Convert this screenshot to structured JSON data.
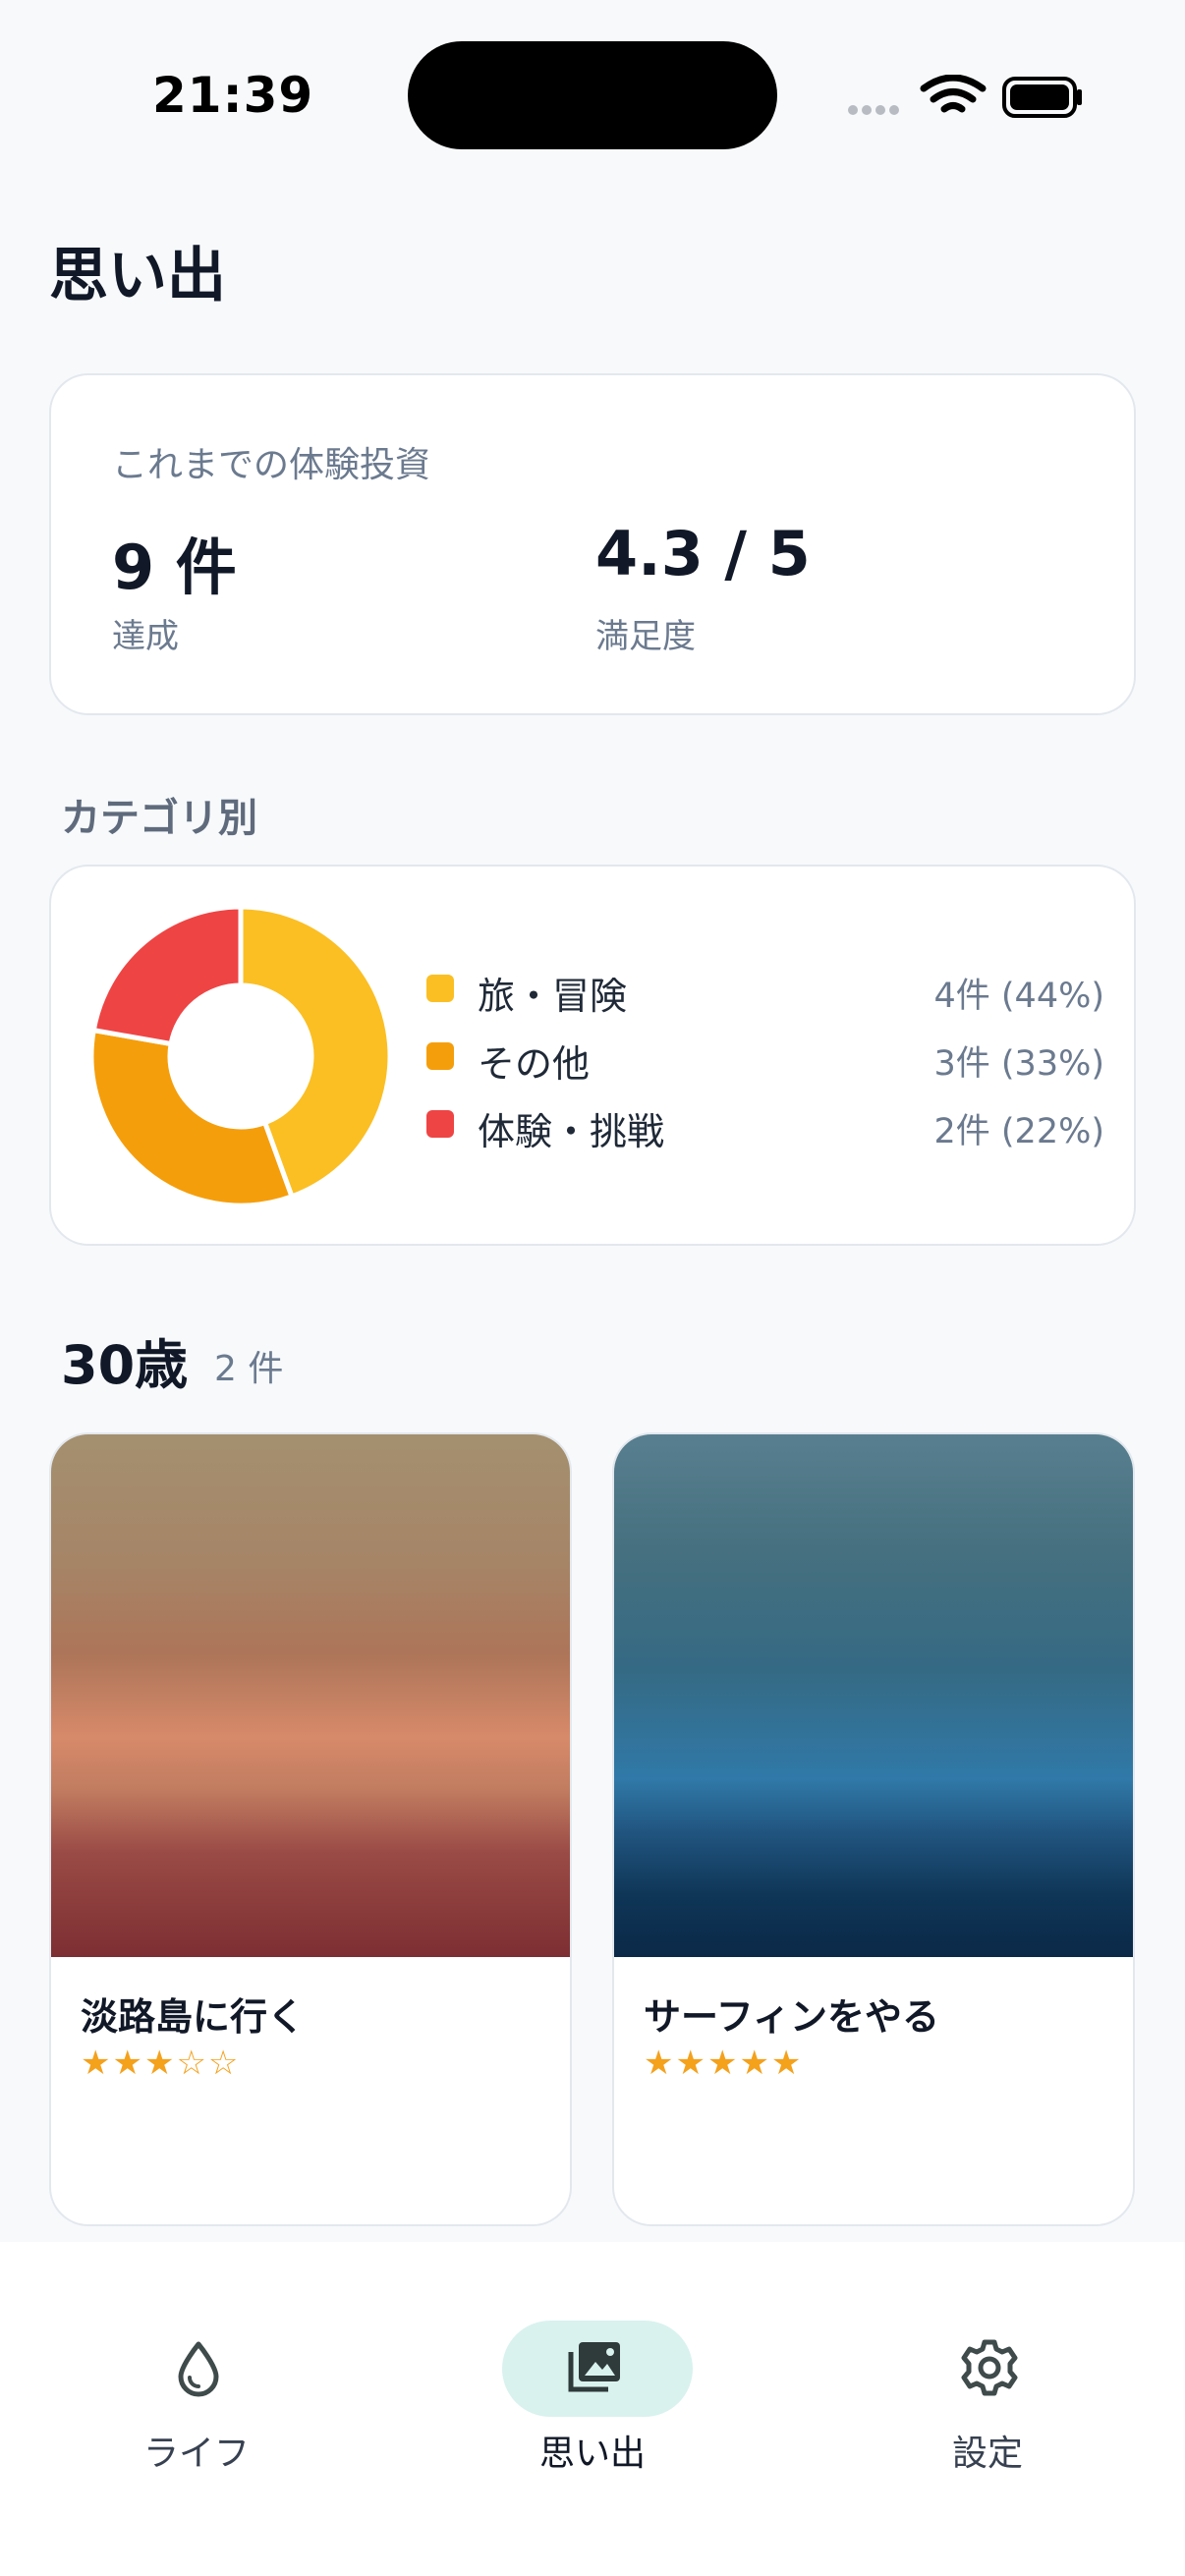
{
  "status_bar": {
    "time": "21:39"
  },
  "page": {
    "title": "思い出"
  },
  "summary": {
    "label": "これまでの体験投資",
    "achieved_value": "9 件",
    "achieved_label": "達成",
    "satisfaction_value": "4.3 / 5",
    "satisfaction_label": "満足度"
  },
  "category_section": {
    "title": "カテゴリ別",
    "items": [
      {
        "name": "旅・冒険",
        "value_text": "4件 (44%)",
        "count": 4,
        "color": "#fbbf24"
      },
      {
        "name": "その他",
        "value_text": "3件 (33%)",
        "count": 3,
        "color": "#f59e0b"
      },
      {
        "name": "体験・挑戦",
        "value_text": "2件 (22%)",
        "count": 2,
        "color": "#ef4444"
      }
    ]
  },
  "age_group": {
    "title": "30歳",
    "count": "2 件",
    "memories": [
      {
        "title": "淡路島に行く",
        "stars": "★★★☆☆",
        "rating": 3
      },
      {
        "title": "サーフィンをやる",
        "stars": "★★★★★",
        "rating": 5
      }
    ]
  },
  "tab_bar": {
    "tabs": [
      {
        "label": "ライフ",
        "icon": "drop-icon",
        "active": false
      },
      {
        "label": "思い出",
        "icon": "photo-library-icon",
        "active": true
      },
      {
        "label": "設定",
        "icon": "gear-icon",
        "active": false
      }
    ],
    "active_color": "#d9f2ee"
  }
}
